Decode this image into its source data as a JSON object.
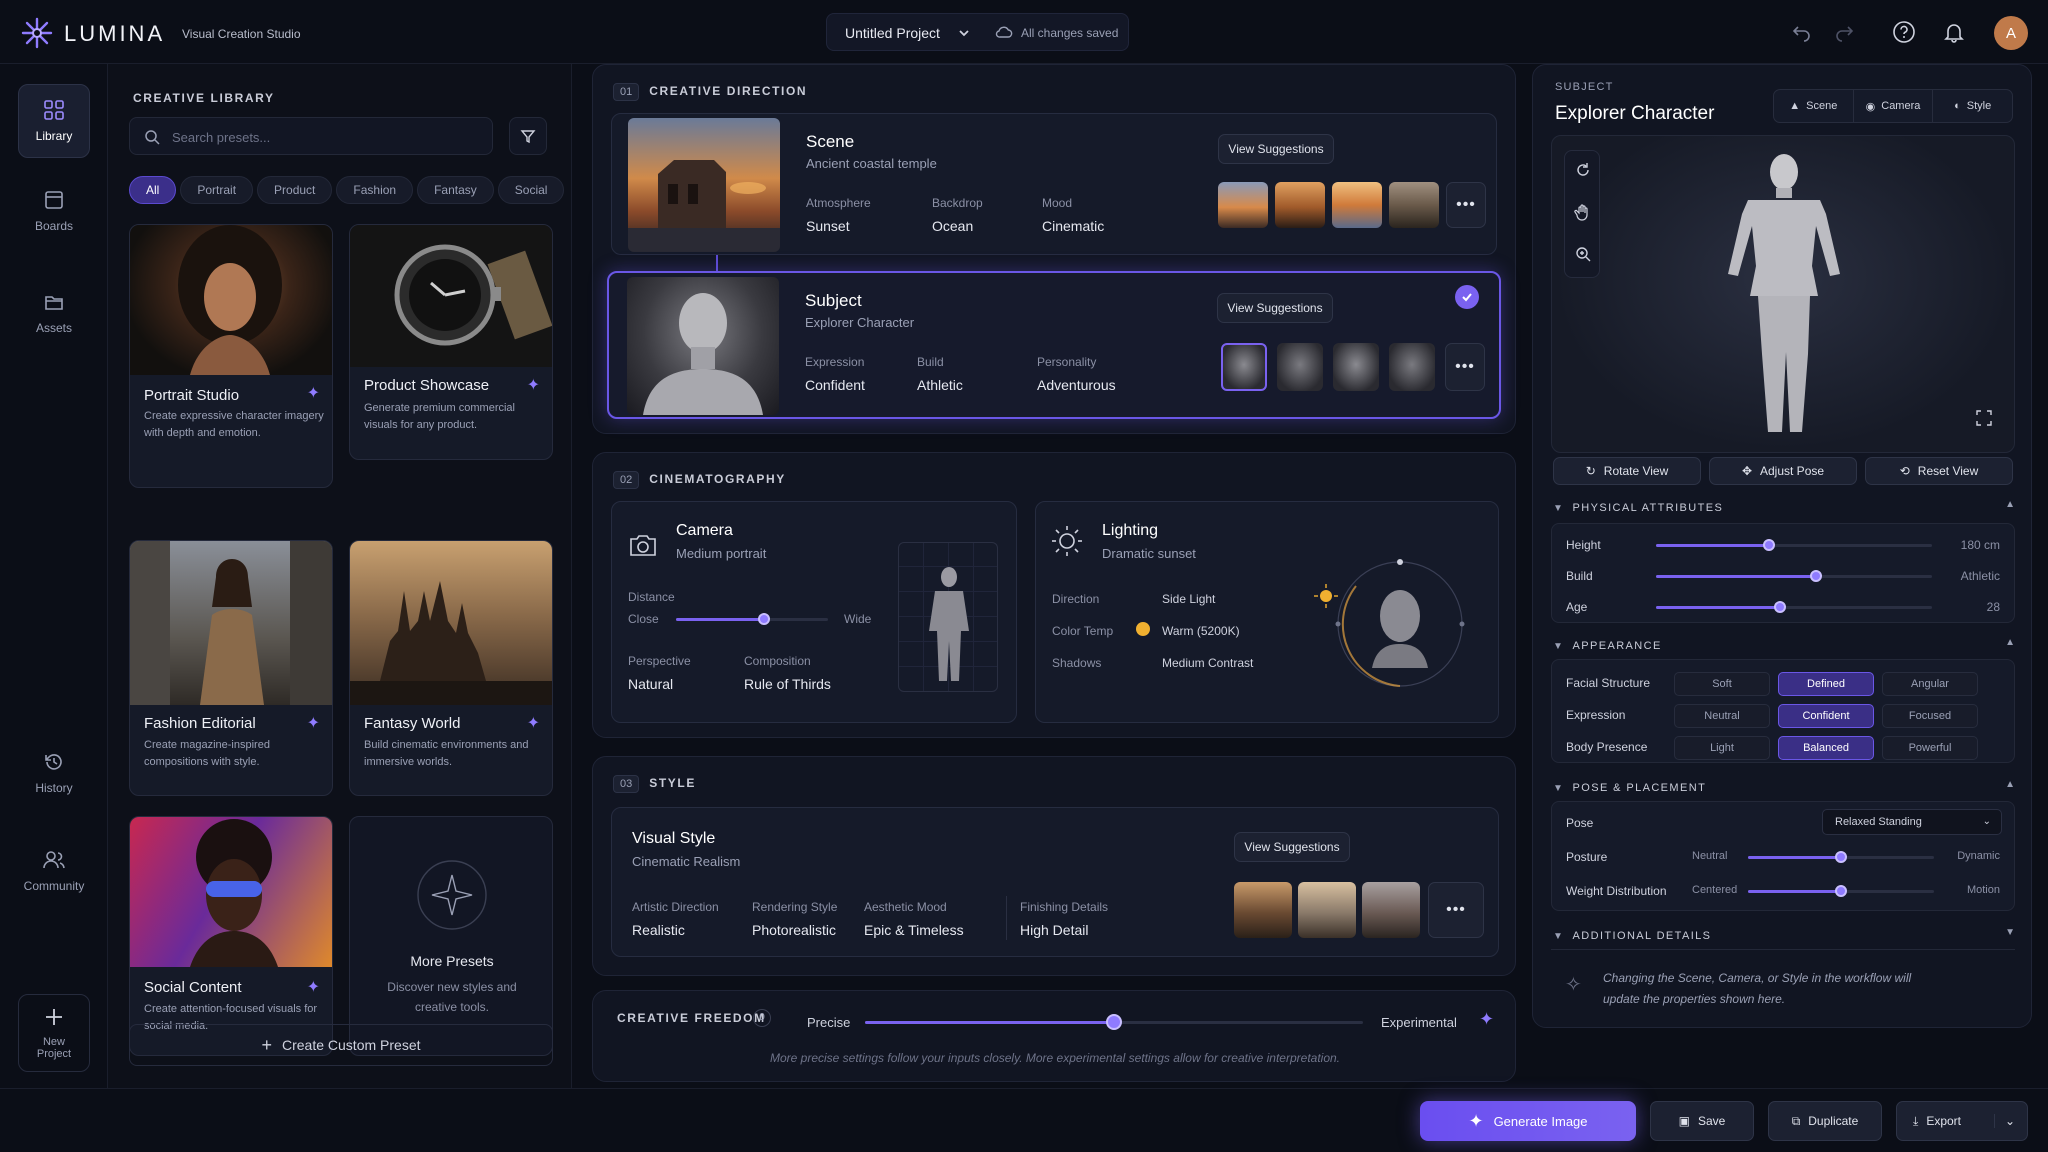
{
  "app": {
    "name": "LUMINA",
    "subtitle": "Visual Creation Studio"
  },
  "header": {
    "project": "Untitled Project",
    "save_status": "All changes saved",
    "avatar": "A"
  },
  "nav": [
    {
      "label": "Library",
      "icon": "library-icon"
    },
    {
      "label": "Boards",
      "icon": "boards-icon"
    },
    {
      "label": "Assets",
      "icon": "folder-icon"
    },
    {
      "label": "History",
      "icon": "history-icon"
    },
    {
      "label": "Community",
      "icon": "community-icon"
    },
    {
      "label": "New Project",
      "icon": "plus-icon"
    }
  ],
  "library": {
    "title": "CREATIVE LIBRARY",
    "search_placeholder": "Search presets...",
    "filters": [
      "All",
      "Portrait",
      "Product",
      "Fashion",
      "Fantasy",
      "Social"
    ],
    "cards": [
      {
        "title": "Portrait Studio",
        "desc": "Create expressive character imagery with depth and emotion."
      },
      {
        "title": "Product Showcase",
        "desc": "Generate premium commercial visuals for any product."
      },
      {
        "title": "Fashion Editorial",
        "desc": "Create magazine-inspired compositions with style."
      },
      {
        "title": "Fantasy World",
        "desc": "Build cinematic environments and immersive worlds."
      },
      {
        "title": "Social Content",
        "desc": "Create attention-focused visuals for social media."
      }
    ],
    "more": {
      "title": "More Presets",
      "desc": "Discover new styles and creative tools."
    },
    "create": "Create Custom Preset"
  },
  "direction": {
    "num": "01",
    "title": "CREATIVE DIRECTION",
    "scene": {
      "title": "Scene",
      "subtitle": "Ancient coastal temple",
      "suggest": "View Suggestions",
      "props": [
        {
          "label": "Atmosphere",
          "value": "Sunset"
        },
        {
          "label": "Backdrop",
          "value": "Ocean"
        },
        {
          "label": "Mood",
          "value": "Cinematic"
        }
      ]
    },
    "subject": {
      "title": "Subject",
      "subtitle": "Explorer Character",
      "suggest": "View Suggestions",
      "props": [
        {
          "label": "Expression",
          "value": "Confident"
        },
        {
          "label": "Build",
          "value": "Athletic"
        },
        {
          "label": "Personality",
          "value": "Adventurous"
        }
      ]
    }
  },
  "cinema": {
    "num": "02",
    "title": "CINEMATOGRAPHY",
    "camera": {
      "title": "Camera",
      "subtitle": "Medium portrait",
      "distance_label": "Distance",
      "close": "Close",
      "wide": "Wide",
      "distance_value": 0.58,
      "perspective_label": "Perspective",
      "perspective": "Natural",
      "composition_label": "Composition",
      "composition": "Rule of Thirds"
    },
    "lighting": {
      "title": "Lighting",
      "subtitle": "Dramatic sunset",
      "direction_label": "Direction",
      "direction": "Side Light",
      "temp_label": "Color Temp",
      "temp": "Warm (5200K)",
      "shadows_label": "Shadows",
      "shadows": "Medium Contrast"
    }
  },
  "style": {
    "num": "03",
    "title": "STYLE",
    "heading": "Visual Style",
    "subtitle": "Cinematic Realism",
    "suggest": "View Suggestions",
    "props": [
      {
        "label": "Artistic Direction",
        "value": "Realistic"
      },
      {
        "label": "Rendering Style",
        "value": "Photorealistic"
      },
      {
        "label": "Aesthetic Mood",
        "value": "Epic & Timeless"
      },
      {
        "label": "Finishing Details",
        "value": "High Detail"
      }
    ]
  },
  "freedom": {
    "title": "CREATIVE FREEDOM",
    "num": "0",
    "left": "Precise",
    "right": "Experimental",
    "value": 0.5,
    "note": "More precise settings follow your inputs closely. More experimental settings allow for creative interpretation."
  },
  "inspector": {
    "kicker": "SUBJECT",
    "title": "Explorer Character",
    "tabs": [
      "Scene",
      "Camera",
      "Style"
    ],
    "view_buttons": [
      "Rotate View",
      "Adjust Pose",
      "Reset View"
    ],
    "physical": {
      "title": "PHYSICAL ATTRIBUTES",
      "rows": [
        {
          "label": "Height",
          "value": "180 cm",
          "pos": 0.41
        },
        {
          "label": "Build",
          "value": "Athletic",
          "pos": 0.58
        },
        {
          "label": "Age",
          "value": "28",
          "pos": 0.45
        }
      ]
    },
    "appearance": {
      "title": "APPEARANCE",
      "rows": [
        {
          "label": "Facial Structure",
          "options": [
            "Soft",
            "Defined",
            "Angular"
          ],
          "selected": 1
        },
        {
          "label": "Expression",
          "options": [
            "Neutral",
            "Confident",
            "Focused"
          ],
          "selected": 1
        },
        {
          "label": "Body Presence",
          "options": [
            "Light",
            "Balanced",
            "Powerful"
          ],
          "selected": 1
        }
      ]
    },
    "pose": {
      "title": "POSE & PLACEMENT",
      "pose_label": "Pose",
      "pose_value": "Relaxed Standing",
      "posture_label": "Posture",
      "posture_left": "Neutral",
      "posture_right": "Dynamic",
      "posture_pos": 0.5,
      "weight_label": "Weight Distribution",
      "weight_left": "Centered",
      "weight_right": "Motion",
      "weight_pos": 0.5
    },
    "additional": {
      "title": "ADDITIONAL DETAILS",
      "note": "Changing the Scene, Camera, or Style in the workflow will update the properties shown here."
    }
  },
  "footer": {
    "generate": "Generate Image",
    "save": "Save",
    "duplicate": "Duplicate",
    "export": "Export"
  },
  "colors": {
    "accent": "#7a62f0",
    "bg": "#0b0e17"
  }
}
